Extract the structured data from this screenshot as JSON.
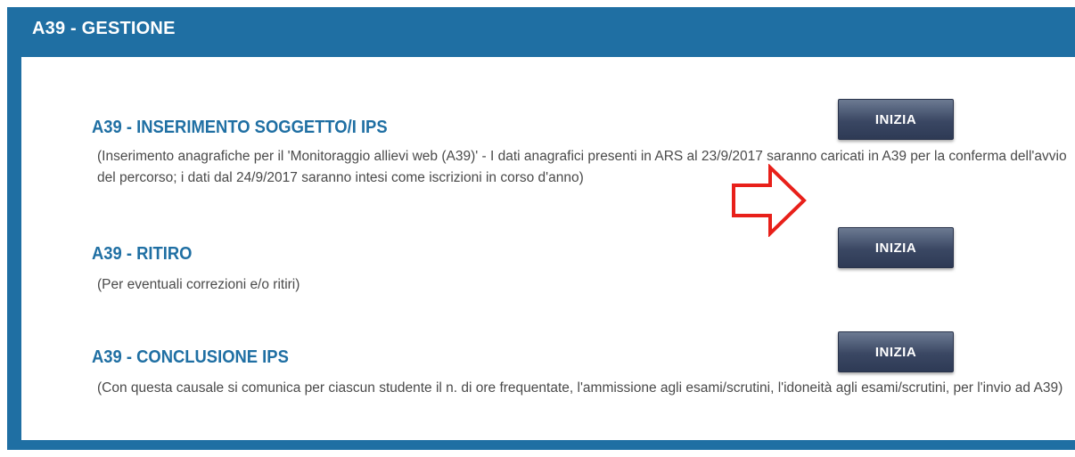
{
  "panel": {
    "title": "A39 - GESTIONE"
  },
  "sections": [
    {
      "title": "A39 - INSERIMENTO SOGGETTO/I IPS",
      "description": "(Inserimento anagrafiche per il 'Monitoraggio allievi web (A39)' - I dati anagrafici presenti in ARS al 23/9/2017 saranno caricati in A39 per la conferma dell'avvio del percorso; i dati dal 24/9/2017 saranno intesi come iscrizioni in corso d'anno)",
      "button_label": "INIZIA"
    },
    {
      "title": "A39 - RITIRO",
      "description": "(Per eventuali correzioni e/o ritiri)",
      "button_label": "INIZIA"
    },
    {
      "title": "A39 - CONCLUSIONE IPS",
      "description": "(Con questa causale si comunica per ciascun studente il n. di ore frequentate, l'ammissione agli esami/scrutini, l'idoneità agli esami/scrutini, per l'invio ad A39)",
      "button_label": "INIZIA"
    }
  ],
  "annotation": {
    "icon": "red-outline-arrow-right-icon",
    "color": "#e8201a"
  }
}
